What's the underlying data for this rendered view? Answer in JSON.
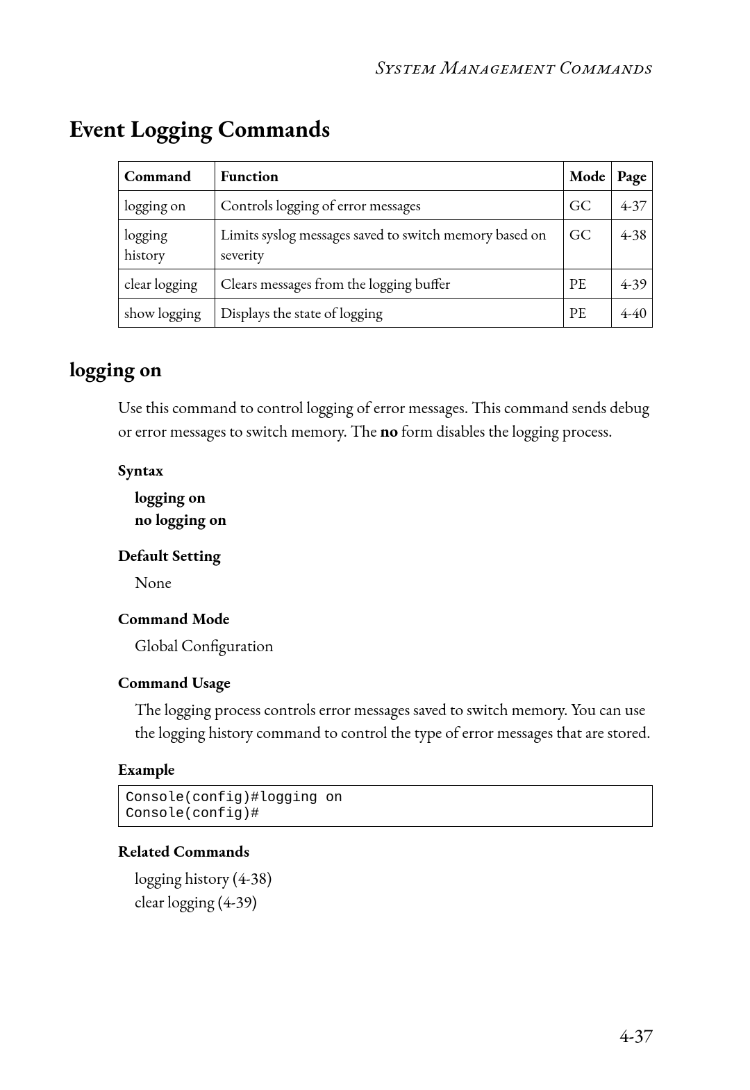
{
  "running_header": "System Management Commands",
  "section_title": "Event Logging Commands",
  "table": {
    "headers": {
      "command": "Command",
      "function": "Function",
      "mode": "Mode",
      "page": "Page"
    },
    "rows": [
      {
        "command": "logging on",
        "function": "Controls logging of error messages",
        "mode": "GC",
        "page": "4-37"
      },
      {
        "command": "logging history",
        "function": "Limits syslog messages saved to switch memory based on severity",
        "mode": "GC",
        "page": "4-38"
      },
      {
        "command": "clear logging",
        "function": "Clears messages from the logging buffer",
        "mode": "PE",
        "page": "4-39"
      },
      {
        "command": "show logging",
        "function": "Displays the state of logging",
        "mode": "PE",
        "page": "4-40"
      }
    ]
  },
  "subsection_title": "logging on",
  "intro": {
    "pre": "Use this command to control logging of error messages. This command sends debug or error messages to switch memory. The ",
    "bold": "no",
    "post": " form disables the logging process."
  },
  "syntax_label": "Syntax",
  "syntax_lines": {
    "l1": "logging on",
    "l2": "no logging on"
  },
  "default_setting_label": "Default Setting",
  "default_setting_value": "None",
  "command_mode_label": "Command Mode",
  "command_mode_value": "Global Configuration",
  "command_usage_label": "Command Usage",
  "command_usage_text": "The logging process controls error messages saved to switch memory. You can use the logging history command to control the type of error messages that are stored.",
  "example_label": "Example",
  "example_text": "Console(config)#logging on\nConsole(config)#",
  "related_commands_label": "Related Commands",
  "related_commands": {
    "r1": "logging history (4-38)",
    "r2": "clear logging (4-39)"
  },
  "page_number": "4-37"
}
